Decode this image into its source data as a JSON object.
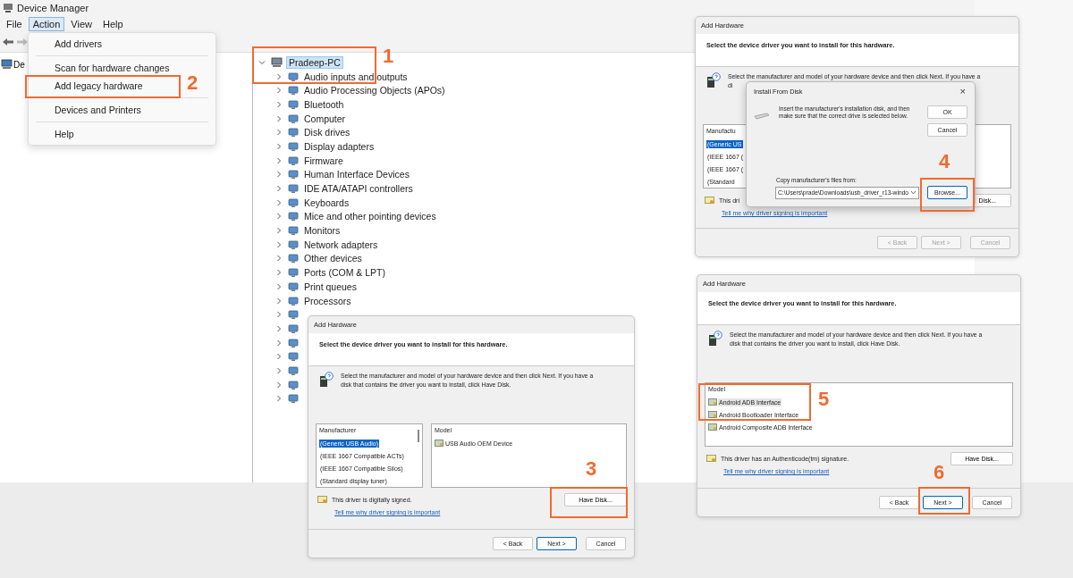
{
  "window": {
    "title": "Device Manager"
  },
  "menu_bar": [
    {
      "label": "File",
      "selected": false
    },
    {
      "label": "Action",
      "selected": true
    },
    {
      "label": "View",
      "selected": false
    },
    {
      "label": "Help",
      "selected": false
    }
  ],
  "action_menu": [
    {
      "kind": "item",
      "label": "Add drivers"
    },
    {
      "kind": "separator"
    },
    {
      "kind": "item",
      "label": "Scan for hardware changes"
    },
    {
      "kind": "item",
      "label": "Add legacy hardware"
    },
    {
      "kind": "separator"
    },
    {
      "kind": "item",
      "label": "Devices and Printers"
    },
    {
      "kind": "separator"
    },
    {
      "kind": "item",
      "label": "Help"
    }
  ],
  "left_pane": {
    "root_label": "De"
  },
  "device_tree": {
    "label": "Pradeep-PC",
    "selected": true,
    "expanded": true,
    "children": [
      {
        "label": "Audio inputs and outputs",
        "expanded": false
      },
      {
        "label": "Audio Processing Objects (APOs)",
        "expanded": false
      },
      {
        "label": "Bluetooth",
        "expanded": false
      },
      {
        "label": "Computer",
        "expanded": false
      },
      {
        "label": "Disk drives",
        "expanded": false
      },
      {
        "label": "Display adapters",
        "expanded": false
      },
      {
        "label": "Firmware",
        "expanded": false
      },
      {
        "label": "Human Interface Devices",
        "expanded": false
      },
      {
        "label": "IDE ATA/ATAPI controllers",
        "expanded": false
      },
      {
        "label": "Keyboards",
        "expanded": false
      },
      {
        "label": "Mice and other pointing devices",
        "expanded": false
      },
      {
        "label": "Monitors",
        "expanded": false
      },
      {
        "label": "Network adapters",
        "expanded": false
      },
      {
        "label": "Other devices",
        "expanded": false
      },
      {
        "label": "Ports (COM & LPT)",
        "expanded": false
      },
      {
        "label": "Print queues",
        "expanded": false
      },
      {
        "label": "Processors",
        "expanded": false
      },
      {
        "expanded": false
      },
      {
        "expanded": false
      },
      {
        "expanded": false
      },
      {
        "expanded": false
      },
      {
        "expanded": false
      },
      {
        "expanded": false
      },
      {
        "expanded": false
      }
    ]
  },
  "dialogs": [
    {
      "title": "Add Hardware",
      "heading": "Select the device driver you want to install for this hardware.",
      "description_lines": [
        "Select the manufacturer and model of your hardware device and then click Next. If you have a",
        "disk that contains the driver you want to install, click Have Disk."
      ],
      "manufacturer_list": {
        "header": "Manufacturer",
        "focused": true,
        "items": [
          {
            "label": "(Generic USB Audio)",
            "selected": true
          },
          {
            "label": "(IEEE 1667 Compatible ACTs)",
            "selected": false
          },
          {
            "label": "(IEEE 1667 Compatible Silos)",
            "selected": false
          },
          {
            "label": "(Standard display tuner)",
            "selected": false
          }
        ]
      },
      "model_list": {
        "header": "Model",
        "items": [
          {
            "label": "USB Audio OEM Device",
            "selected": false
          }
        ]
      },
      "signature": "This driver is digitally signed.",
      "link": "Tell me why driver signing is important",
      "have_disk": "Have Disk...",
      "buttons": [
        {
          "label": "< Back",
          "default": false,
          "disabled": false
        },
        {
          "label": "Next >",
          "default": true,
          "disabled": false
        },
        {
          "label": "Cancel",
          "default": false,
          "disabled": false
        }
      ]
    },
    {
      "title": "Add Hardware",
      "heading": "Select the device driver you want to install for this hardware.",
      "description_lines": [
        "Select the manufacturer and model of your hardware device and then click Next. If you have a",
        "di"
      ],
      "manufacturer_list": {
        "header": "Manufactu",
        "focused": true,
        "items": [
          {
            "label": "(Generic US",
            "selected": true
          },
          {
            "label": "(IEEE 1667 (",
            "selected": false
          },
          {
            "label": "(IEEE 1667 (",
            "selected": false
          },
          {
            "label": "(Standard",
            "selected": false
          }
        ]
      },
      "signature": "This dri",
      "link": "Tell me why driver signing is important",
      "have_disk": "Disk...",
      "buttons": [
        {
          "label": "< Back",
          "default": false,
          "disabled": true
        },
        {
          "label": "Next >",
          "default": false,
          "disabled": true
        },
        {
          "label": "Cancel",
          "default": false,
          "disabled": true
        }
      ],
      "install_from_disk": {
        "title": "Install From Disk",
        "close": "×",
        "instruction_lines": [
          "Insert the manufacturer's installation disk, and then",
          "make sure that the correct drive is selected below."
        ],
        "ok": "OK",
        "cancel": "Cancel",
        "path_label": "Copy manufacturer's files from:",
        "path_value": "C:\\Users\\prade\\Downloads\\usb_driver_r13-windo",
        "browse": "Browse..."
      }
    },
    {
      "title": "Add Hardware",
      "heading": "Select the device driver you want to install for this hardware.",
      "description_lines": [
        "Select the manufacturer and model of your hardware device and then click Next. If you have a",
        "disk that contains the driver you want to install, click Have Disk."
      ],
      "model_list": {
        "header": "Model",
        "focused": false,
        "items": [
          {
            "label": "Android ADB Interface",
            "selected": true
          },
          {
            "label": "Android Bootloader Interface",
            "selected": false
          },
          {
            "label": "Android Composite ADB Interface",
            "selected": false
          }
        ]
      },
      "signature": "This driver has an Authenticode(tm) signature.",
      "link": "Tell me why driver signing is important",
      "have_disk": "Have Disk...",
      "buttons": [
        {
          "label": "< Back",
          "default": false,
          "disabled": false
        },
        {
          "label": "Next >",
          "default": true,
          "disabled": false
        },
        {
          "label": "Cancel",
          "default": false,
          "disabled": false
        }
      ]
    }
  ],
  "annotations": [
    {
      "label": "1"
    },
    {
      "label": "2"
    },
    {
      "label": "3"
    },
    {
      "label": "4"
    },
    {
      "label": "5"
    },
    {
      "label": "6"
    }
  ]
}
